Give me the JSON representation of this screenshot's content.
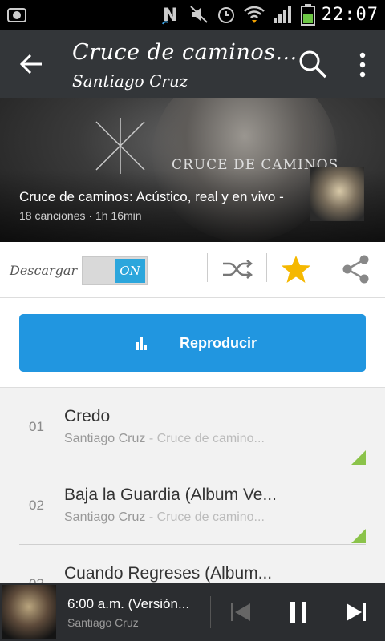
{
  "status_bar": {
    "time": "22:07",
    "icons": [
      "screenshot-icon",
      "nfc-n-icon",
      "mute-icon",
      "alarm-icon",
      "wifi-icon",
      "signal-icon",
      "battery-icon"
    ]
  },
  "action_bar": {
    "title": "Cruce de caminos...",
    "subtitle": "Santiago Cruz"
  },
  "hero": {
    "brand_text": "CRUCE DE CAMINOS",
    "album_title": "Cruce de caminos: Acústico, real y en vivo -",
    "album_meta": "18 canciones · 1h 16min"
  },
  "options": {
    "download_label": "Descargar",
    "toggle_label": "ON",
    "favorite_color": "#f5b800"
  },
  "play": {
    "label": "Reproducir",
    "color": "#2196e0"
  },
  "tracks": [
    {
      "number": "01",
      "title": "Credo",
      "artist": "Santiago Cruz",
      "album": " - Cruce de camino..."
    },
    {
      "number": "02",
      "title": "Baja la Guardia (Album Ve...",
      "artist": "Santiago Cruz",
      "album": " - Cruce de camino..."
    },
    {
      "number": "03",
      "title": "Cuando Regreses (Album...",
      "artist": "",
      "album": ""
    }
  ],
  "now_playing": {
    "title": "6:00 a.m. (Versión...",
    "artist": "Santiago Cruz"
  },
  "colors": {
    "accent": "#2196e0",
    "toggle_on": "#2ca6dc",
    "download_marker": "#8bc34a",
    "action_bar": "#333639"
  }
}
